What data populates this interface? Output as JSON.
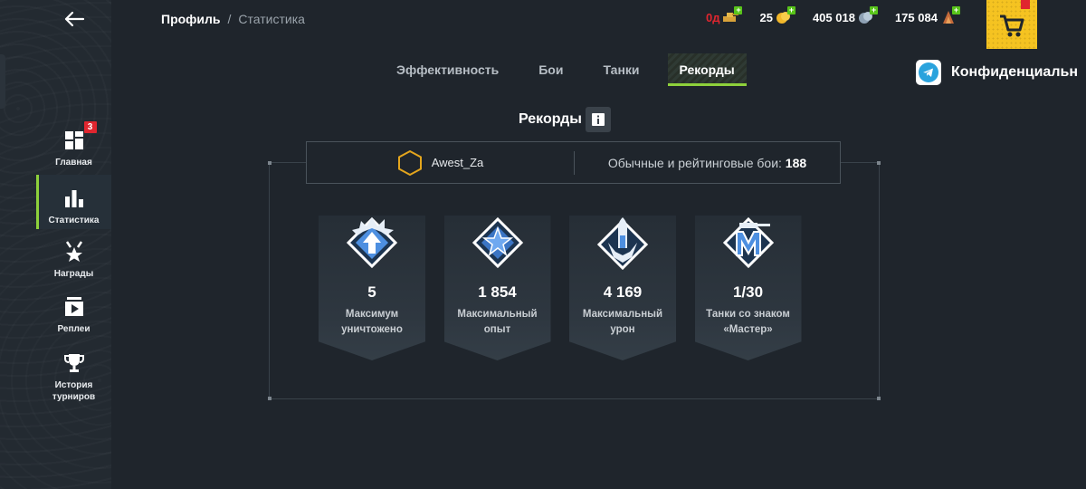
{
  "header": {
    "breadcrumb": {
      "profile": "Профиль",
      "separator": "/",
      "current": "Статистика"
    },
    "currencies": [
      {
        "id": "premium-days",
        "value": "0д",
        "color": "#e0262f",
        "icon": "premium-tank-icon"
      },
      {
        "id": "gold",
        "value": "25",
        "color": "#ffffff",
        "icon": "gold-coins-icon"
      },
      {
        "id": "credits",
        "value": "405 018",
        "color": "#ffffff",
        "icon": "silver-coins-icon"
      },
      {
        "id": "free-xp",
        "value": "175 084",
        "color": "#ffffff",
        "icon": "free-xp-icon"
      }
    ],
    "shop_icon": "shopping-cart-icon"
  },
  "telegram": {
    "label": "Конфиденциальн",
    "icon": "telegram-icon"
  },
  "sidebar": {
    "items": [
      {
        "label": "Главная",
        "icon": "home-icon",
        "badge": "3"
      },
      {
        "label": "Статистика",
        "icon": "statistics-icon",
        "active": true
      },
      {
        "label": "Награды",
        "icon": "awards-icon"
      },
      {
        "label": "Реплеи",
        "icon": "replays-icon"
      },
      {
        "label": "История турниров",
        "icon": "tournament-trophy-icon"
      }
    ]
  },
  "tabs": [
    {
      "label": "Эффективность"
    },
    {
      "label": "Бои"
    },
    {
      "label": "Танки"
    },
    {
      "label": "Рекорды",
      "active": true
    }
  ],
  "section": {
    "title": "Рекорды",
    "info_icon": "info-icon"
  },
  "player": {
    "name": "Awest_Za",
    "battles_label": "Обычные и рейтинговые бои:",
    "battles_value": "188"
  },
  "records": [
    {
      "value": "5",
      "caption_line1": "Максимум",
      "caption_line2": "уничтожено",
      "icon": "max-destroyed-medal-icon"
    },
    {
      "value": "1 854",
      "caption_line1": "Максимальный",
      "caption_line2": "опыт",
      "icon": "max-xp-medal-icon"
    },
    {
      "value": "4 169",
      "caption_line1": "Максимальный",
      "caption_line2": "урон",
      "icon": "max-damage-medal-icon"
    },
    {
      "value": "1/30",
      "caption_line1": "Танки со знаком",
      "caption_line2": "«Мастер»",
      "icon": "mastery-badge-medal-icon"
    }
  ],
  "colors": {
    "accent": "#8ed13b",
    "background": "#1f252c",
    "sidebar": "#232a31",
    "badge": "#e0262f",
    "shop": "#f5c321",
    "medal_blue": "#4d8fe0"
  }
}
